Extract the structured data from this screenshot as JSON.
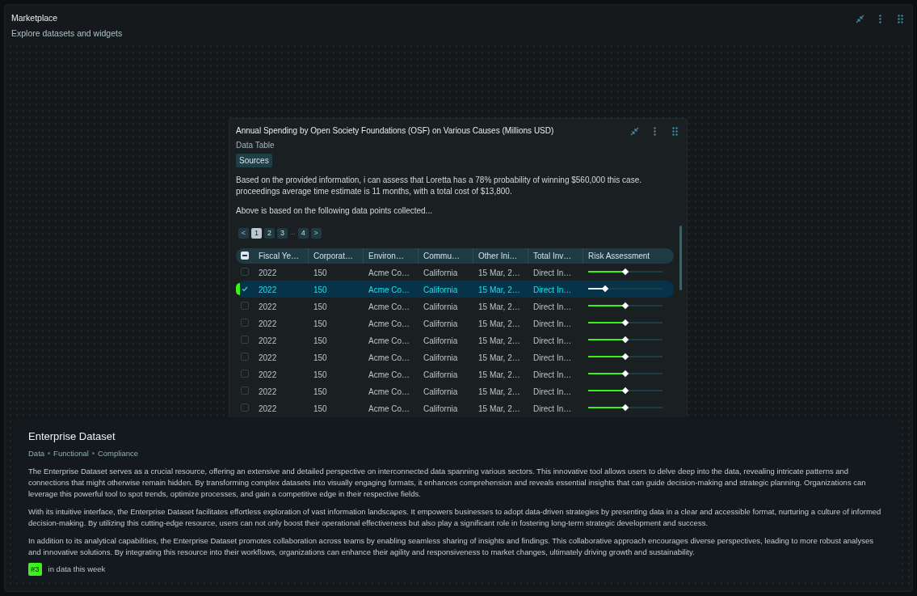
{
  "header": {
    "title": "Marketplace",
    "subtitle": "Explore datasets and widgets"
  },
  "widget": {
    "title": "Annual Spending by Open Society Foundations (OSF) on Various Causes (Millions USD)",
    "subtitle": "Data Table",
    "tag": "Sources",
    "summary": "Based on the provided information, i can assess that Loretta has a 78% probability of winning $560,000 this case. proceedings average time estimate is 11 months, with a total cost of $13,800.",
    "note": "Above is based on the following data points collected...",
    "pagination": [
      {
        "label": "<",
        "kind": "arrow"
      },
      {
        "label": "1",
        "kind": "page",
        "selected": true
      },
      {
        "label": "2",
        "kind": "page",
        "selected": false
      },
      {
        "label": "3",
        "kind": "page",
        "selected": false
      },
      {
        "label": "...",
        "kind": "gap"
      },
      {
        "label": "4",
        "kind": "page",
        "selected": false
      },
      {
        "label": ">",
        "kind": "arrow"
      }
    ],
    "table": {
      "select_all_indeterminate": true,
      "columns": [
        "Fiscal Ye…",
        "Corporat…",
        "Environ…",
        "Commu…",
        "Other Ini…",
        "Total Inv…",
        "Risk Assessment"
      ],
      "rows": [
        {
          "selected": false,
          "cells": [
            "2022",
            "150",
            "Acme Co…",
            "California",
            "15 Mar, 2…",
            "Direct In…"
          ],
          "level": 0.5
        },
        {
          "selected": true,
          "cells": [
            "2022",
            "150",
            "Acme Co…",
            "California",
            "15 Mar, 2…",
            "Direct In…"
          ],
          "level": 0.23
        },
        {
          "selected": false,
          "cells": [
            "2022",
            "150",
            "Acme Co…",
            "California",
            "15 Mar, 2…",
            "Direct In…"
          ],
          "level": 0.5
        },
        {
          "selected": false,
          "cells": [
            "2022",
            "150",
            "Acme Co…",
            "California",
            "15 Mar, 2…",
            "Direct In…"
          ],
          "level": 0.5
        },
        {
          "selected": false,
          "cells": [
            "2022",
            "150",
            "Acme Co…",
            "California",
            "15 Mar, 2…",
            "Direct In…"
          ],
          "level": 0.5
        },
        {
          "selected": false,
          "cells": [
            "2022",
            "150",
            "Acme Co…",
            "California",
            "15 Mar, 2…",
            "Direct In…"
          ],
          "level": 0.5
        },
        {
          "selected": false,
          "cells": [
            "2022",
            "150",
            "Acme Co…",
            "California",
            "15 Mar, 2…",
            "Direct In…"
          ],
          "level": 0.5
        },
        {
          "selected": false,
          "cells": [
            "2022",
            "150",
            "Acme Co…",
            "California",
            "15 Mar, 2…",
            "Direct In…"
          ],
          "level": 0.5
        },
        {
          "selected": false,
          "cells": [
            "2022",
            "150",
            "Acme Co…",
            "California",
            "15 Mar, 2…",
            "Direct In…"
          ],
          "level": 0.5
        }
      ]
    }
  },
  "details": {
    "title": "Enterprise Dataset",
    "tags": [
      "Data",
      "Functional",
      "Compliance"
    ],
    "paragraphs": [
      "The Enterprise Dataset serves as a crucial resource, offering an extensive and detailed perspective on interconnected data spanning various sectors. This innovative tool allows users to delve deep into the data, revealing intricate patterns and connections that might otherwise remain hidden. By transforming complex datasets into visually engaging formats, it enhances comprehension and reveals essential insights that can guide decision-making and strategic planning. Organizations can leverage this powerful tool to spot trends, optimize processes, and gain a competitive edge in their respective fields.",
      "With its intuitive interface, the Enterprise Dataset facilitates effortless exploration of vast information landscapes. It empowers businesses to adopt data-driven strategies by presenting data in a clear and accessible format, nurturing a culture of informed decision-making. By utilizing this cutting-edge resource, users can not only boost their operational effectiveness but also play a significant role in fostering long-term strategic development and success.",
      "In addition to its analytical capabilities, the Enterprise Dataset promotes collaboration across teams by enabling seamless sharing of insights and findings. This collaborative approach encourages diverse perspectives, leading to more robust analyses and innovative solutions. By integrating this resource into their workflows, organizations can enhance their agility and responsiveness to market changes, ultimately driving growth and sustainability."
    ],
    "rank": "#3",
    "rank_caption": "in data this week"
  }
}
